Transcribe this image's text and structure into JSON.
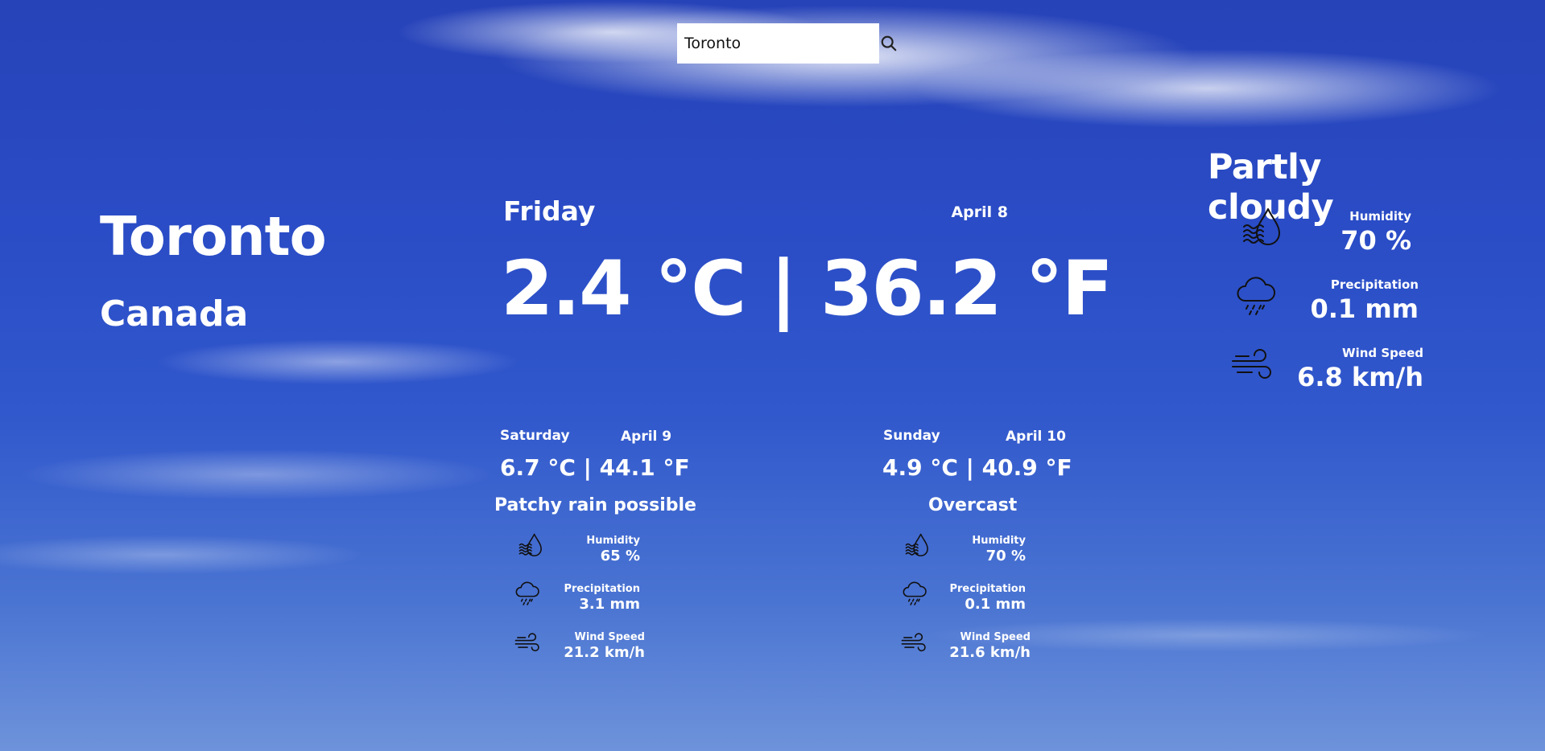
{
  "search": {
    "value": "Toronto"
  },
  "location": {
    "city": "Toronto",
    "country": "Canada"
  },
  "current": {
    "day": "Friday",
    "date": "April 8",
    "temperature": "2.4 °C | 36.2 °F",
    "condition": "Partly cloudy",
    "humidity_label": "Humidity",
    "humidity": "70 %",
    "precipitation_label": "Precipitation",
    "precipitation": "0.1 mm",
    "wind_label": "Wind Speed",
    "wind": "6.8 km/h"
  },
  "forecast": [
    {
      "day": "Saturday",
      "date": "April 9",
      "temperature": "6.7 °C | 44.1 °F",
      "condition": "Patchy rain possible",
      "humidity_label": "Humidity",
      "humidity": "65 %",
      "precipitation_label": "Precipitation",
      "precipitation": "3.1 mm",
      "wind_label": "Wind Speed",
      "wind": "21.2 km/h"
    },
    {
      "day": "Sunday",
      "date": "April 10",
      "temperature": "4.9 °C | 40.9 °F",
      "condition": "Overcast",
      "humidity_label": "Humidity",
      "humidity": "70 %",
      "precipitation_label": "Precipitation",
      "precipitation": "0.1 mm",
      "wind_label": "Wind Speed",
      "wind": "21.6 km/h"
    }
  ],
  "icons": {
    "search": "search-icon",
    "humidity": "humidity-icon",
    "precipitation": "rain-cloud-icon",
    "wind": "wind-icon"
  },
  "colors": {
    "text": "#ffffff",
    "icon": "#111111",
    "search_bg": "#ffffff"
  }
}
